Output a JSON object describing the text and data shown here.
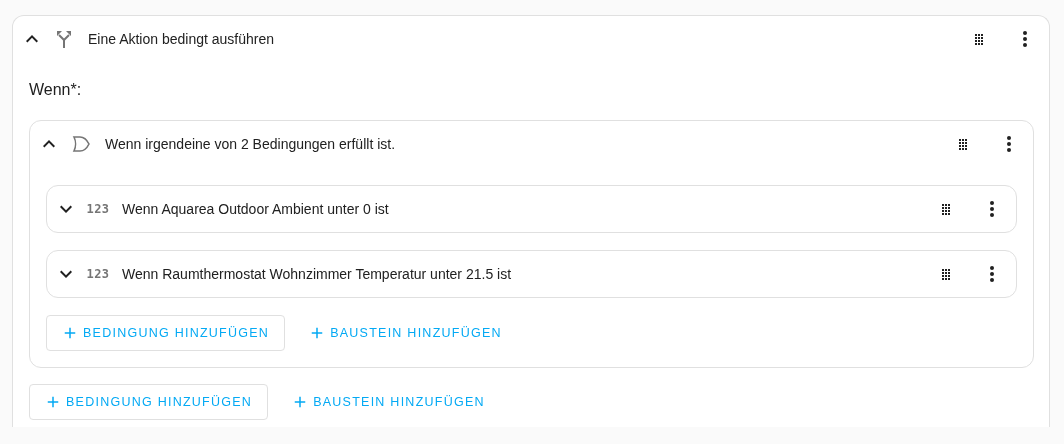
{
  "action": {
    "kind": "choose",
    "expanded": true,
    "title": "Eine Aktion bedingt ausführen",
    "section_label": "Wenn*:",
    "conditions": [
      {
        "kind": "or",
        "expanded": true,
        "title": "Wenn irgendeine von 2 Bedingungen erfüllt ist.",
        "children": [
          {
            "kind": "numeric",
            "icon_text": "123",
            "expanded": false,
            "title": "Wenn Aquarea Outdoor Ambient unter 0 ist"
          },
          {
            "kind": "numeric",
            "icon_text": "123",
            "expanded": false,
            "title": "Wenn Raumthermostat Wohnzimmer Temperatur unter 21.5 ist"
          }
        ],
        "buttons": [
          {
            "kind": "outlined",
            "label": "BEDINGUNG HINZUFÜGEN"
          },
          {
            "kind": "text",
            "label": "BAUSTEIN HINZUFÜGEN"
          }
        ]
      }
    ],
    "buttons": [
      {
        "kind": "outlined",
        "label": "BEDINGUNG HINZUFÜGEN"
      },
      {
        "kind": "text",
        "label": "BAUSTEIN HINZUFÜGEN"
      }
    ]
  }
}
